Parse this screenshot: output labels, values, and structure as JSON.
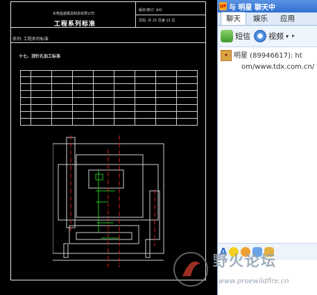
{
  "cad": {
    "company": "东莞昌盛模具制造有限公司",
    "title": "工程系列标准",
    "version": "版本/修订:  A/0",
    "page_info": "页码: 共 25 页第 15 页",
    "section": "系列: 工程系列标准",
    "heading": "十七、顶针孔加工标准"
  },
  "chat": {
    "title": "与 明星 聊天中",
    "tabs": [
      "聊天",
      "娱乐",
      "应用"
    ],
    "toolbar": {
      "sms": "短信",
      "video": "视频"
    },
    "message_line1": "明星 (89946617): ht",
    "message_line2": "om/www.tdx.com.cn/"
  },
  "watermark": {
    "cn": "野火论坛",
    "url": "www.proewildfire.cn"
  },
  "colors": {
    "accent": "#2f6fd1",
    "cad_bg": "#000000",
    "cad_green": "#19c219",
    "cad_red": "#e02020"
  }
}
